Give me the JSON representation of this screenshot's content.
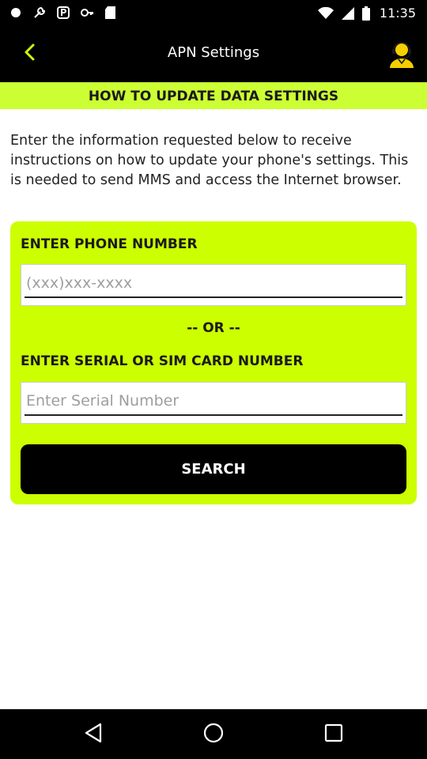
{
  "status_bar": {
    "time": "11:35",
    "left_icons": [
      "notification-dot-icon",
      "wrench-icon",
      "signal-p-icon",
      "key-icon",
      "sd-card-icon"
    ],
    "right_icons": [
      "wifi-icon",
      "cell-signal-icon",
      "battery-icon"
    ]
  },
  "app_bar": {
    "title": "APN Settings",
    "back_icon": "chevron-left-icon",
    "support_icon": "support-agent-icon"
  },
  "banner": {
    "text": "HOW TO UPDATE DATA SETTINGS"
  },
  "intro": {
    "text": "Enter the information requested below to receive instructions on how to update your phone's settings. This is needed to send MMS and access the Internet browser."
  },
  "form": {
    "phone_label": "ENTER PHONE NUMBER",
    "phone_value": "",
    "phone_placeholder": "(xxx)xxx-xxxx",
    "or_label": "-- OR --",
    "serial_label": "ENTER SERIAL OR SIM CARD NUMBER",
    "serial_value": "",
    "serial_placeholder": "Enter Serial Number",
    "search_label": "SEARCH"
  },
  "nav_bar": {
    "icons": [
      "nav-back-icon",
      "nav-home-icon",
      "nav-recents-icon"
    ]
  },
  "colors": {
    "accent": "#ccff00",
    "banner": "#ccff33",
    "bar": "#000000",
    "support_icon": "#f5d000"
  }
}
